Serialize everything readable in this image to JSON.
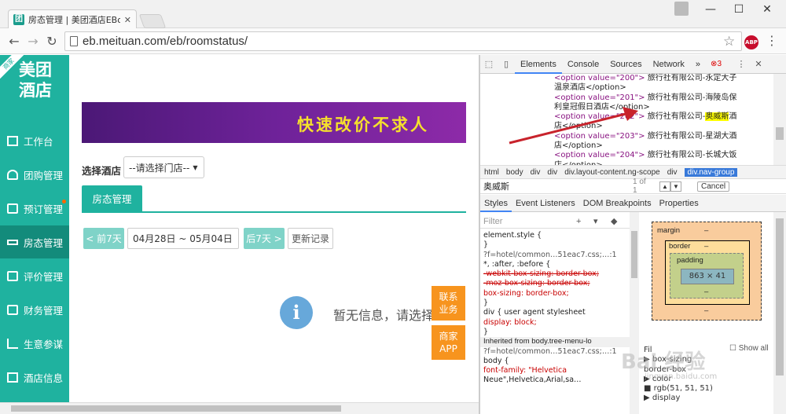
{
  "browser": {
    "tab_title": "房态管理 | 美团酒店EBooki",
    "favicon_text": "团",
    "url": "eb.meituan.com/eb/roomstatus/",
    "abp_label": "ABP"
  },
  "sidebar": {
    "logo_line1": "美团",
    "logo_line2": "酒店",
    "ribbon": "商家",
    "items": [
      {
        "label": "工作台"
      },
      {
        "label": "团购管理"
      },
      {
        "label": "预订管理"
      },
      {
        "label": "房态管理"
      },
      {
        "label": "评价管理"
      },
      {
        "label": "财务管理"
      },
      {
        "label": "生意参谋"
      },
      {
        "label": "酒店信息"
      }
    ]
  },
  "main": {
    "banner_text": "快速改价不求人",
    "hotel_label": "选择酒店",
    "hotel_select": "--请选择门店--",
    "tab_room": "房态管理",
    "prev_btn": "< 前7天",
    "date_range": "04月28日 ~ 05月04日",
    "next_btn": "后7天 >",
    "history_btn": "更新记录",
    "empty_text": "暂无信息，请选择",
    "float_contact": "联系\n业务",
    "float_app": "商家\nAPP"
  },
  "devtools": {
    "tabs": [
      "Elements",
      "Console",
      "Sources",
      "Network"
    ],
    "more": "»",
    "error_count": "3",
    "dom_lines": [
      {
        "tag": "<option value=\"200\">",
        "text": "旅行社有限公司-永定大子"
      },
      {
        "tag": "",
        "text": "温泉酒店</option>"
      },
      {
        "tag": "<option value=\"201\">",
        "text": "旅行社有限公司-海陵岛保"
      },
      {
        "tag": "",
        "text": "利皇冠假日酒店</option>"
      },
      {
        "tag": "<option value=\"202\">",
        "text": "旅行社有限公司-",
        "hl": "奥威斯",
        "after": "酒"
      },
      {
        "tag": "",
        "text": "店</option>"
      },
      {
        "tag": "<option value=\"203\">",
        "text": "旅行社有限公司-星湖大酒"
      },
      {
        "tag": "",
        "text": "店</option>"
      },
      {
        "tag": "<option value=\"204\">",
        "text": "旅行社有限公司-长城大饭"
      },
      {
        "tag": "",
        "text": "店</option>"
      }
    ],
    "crumbs": [
      "html",
      "body",
      "div",
      "div",
      "div.layout-content.ng-scope",
      "div"
    ],
    "crumb_current": "div.nav-group",
    "search_value": "奥威斯",
    "search_count": "1 of 1",
    "cancel": "Cancel",
    "subtabs": [
      "Styles",
      "Event Listeners",
      "DOM Breakpoints",
      "Properties"
    ],
    "filter": "Filter",
    "styles_lines": [
      {
        "t": "element.style {",
        "c": ""
      },
      {
        "t": "}",
        "c": ""
      },
      {
        "t": "?f=hotel/common…51eac7.css;…:1",
        "c": "src"
      },
      {
        "t": "*, :after, :before {",
        "c": ""
      },
      {
        "t": "  -webkit-box-sizing: border-box;",
        "c": "strike"
      },
      {
        "t": "  -moz-box-sizing: border-box;",
        "c": "strike"
      },
      {
        "t": "  box-sizing: border-box;",
        "c": "prop"
      },
      {
        "t": "}",
        "c": ""
      },
      {
        "t": "div {        user agent stylesheet",
        "c": ""
      },
      {
        "t": "  display: block;",
        "c": "prop"
      },
      {
        "t": "}",
        "c": ""
      },
      {
        "t": "Inherited from body.tree-menu-lo",
        "c": "inh"
      },
      {
        "t": "?f=hotel/common…51eac7.css;…:1",
        "c": "src"
      },
      {
        "t": "body {",
        "c": ""
      },
      {
        "t": "  font-family: \"Helvetica",
        "c": "prop"
      },
      {
        "t": "    Neue\",Helvetica,Arial,sa…",
        "c": ""
      }
    ],
    "boxmodel": {
      "margin": "margin",
      "border": "border",
      "padding": "padding",
      "content": "863 × 41",
      "dash": "–"
    },
    "computed_lines": [
      "Fil",
      "▶ box-sizing",
      "  border-box",
      "▶ color",
      "  ■ rgb(51, 51, 51)",
      "▶ display"
    ],
    "show_all": "Show all"
  },
  "watermark": "Bai 经验",
  "watermark_sub": "jingyan.baidu.com",
  "colors": {
    "brand": "#1fb29f",
    "brand_dark": "#138b7b",
    "orange": "#f7941e",
    "banner_text": "#f5e12c"
  }
}
